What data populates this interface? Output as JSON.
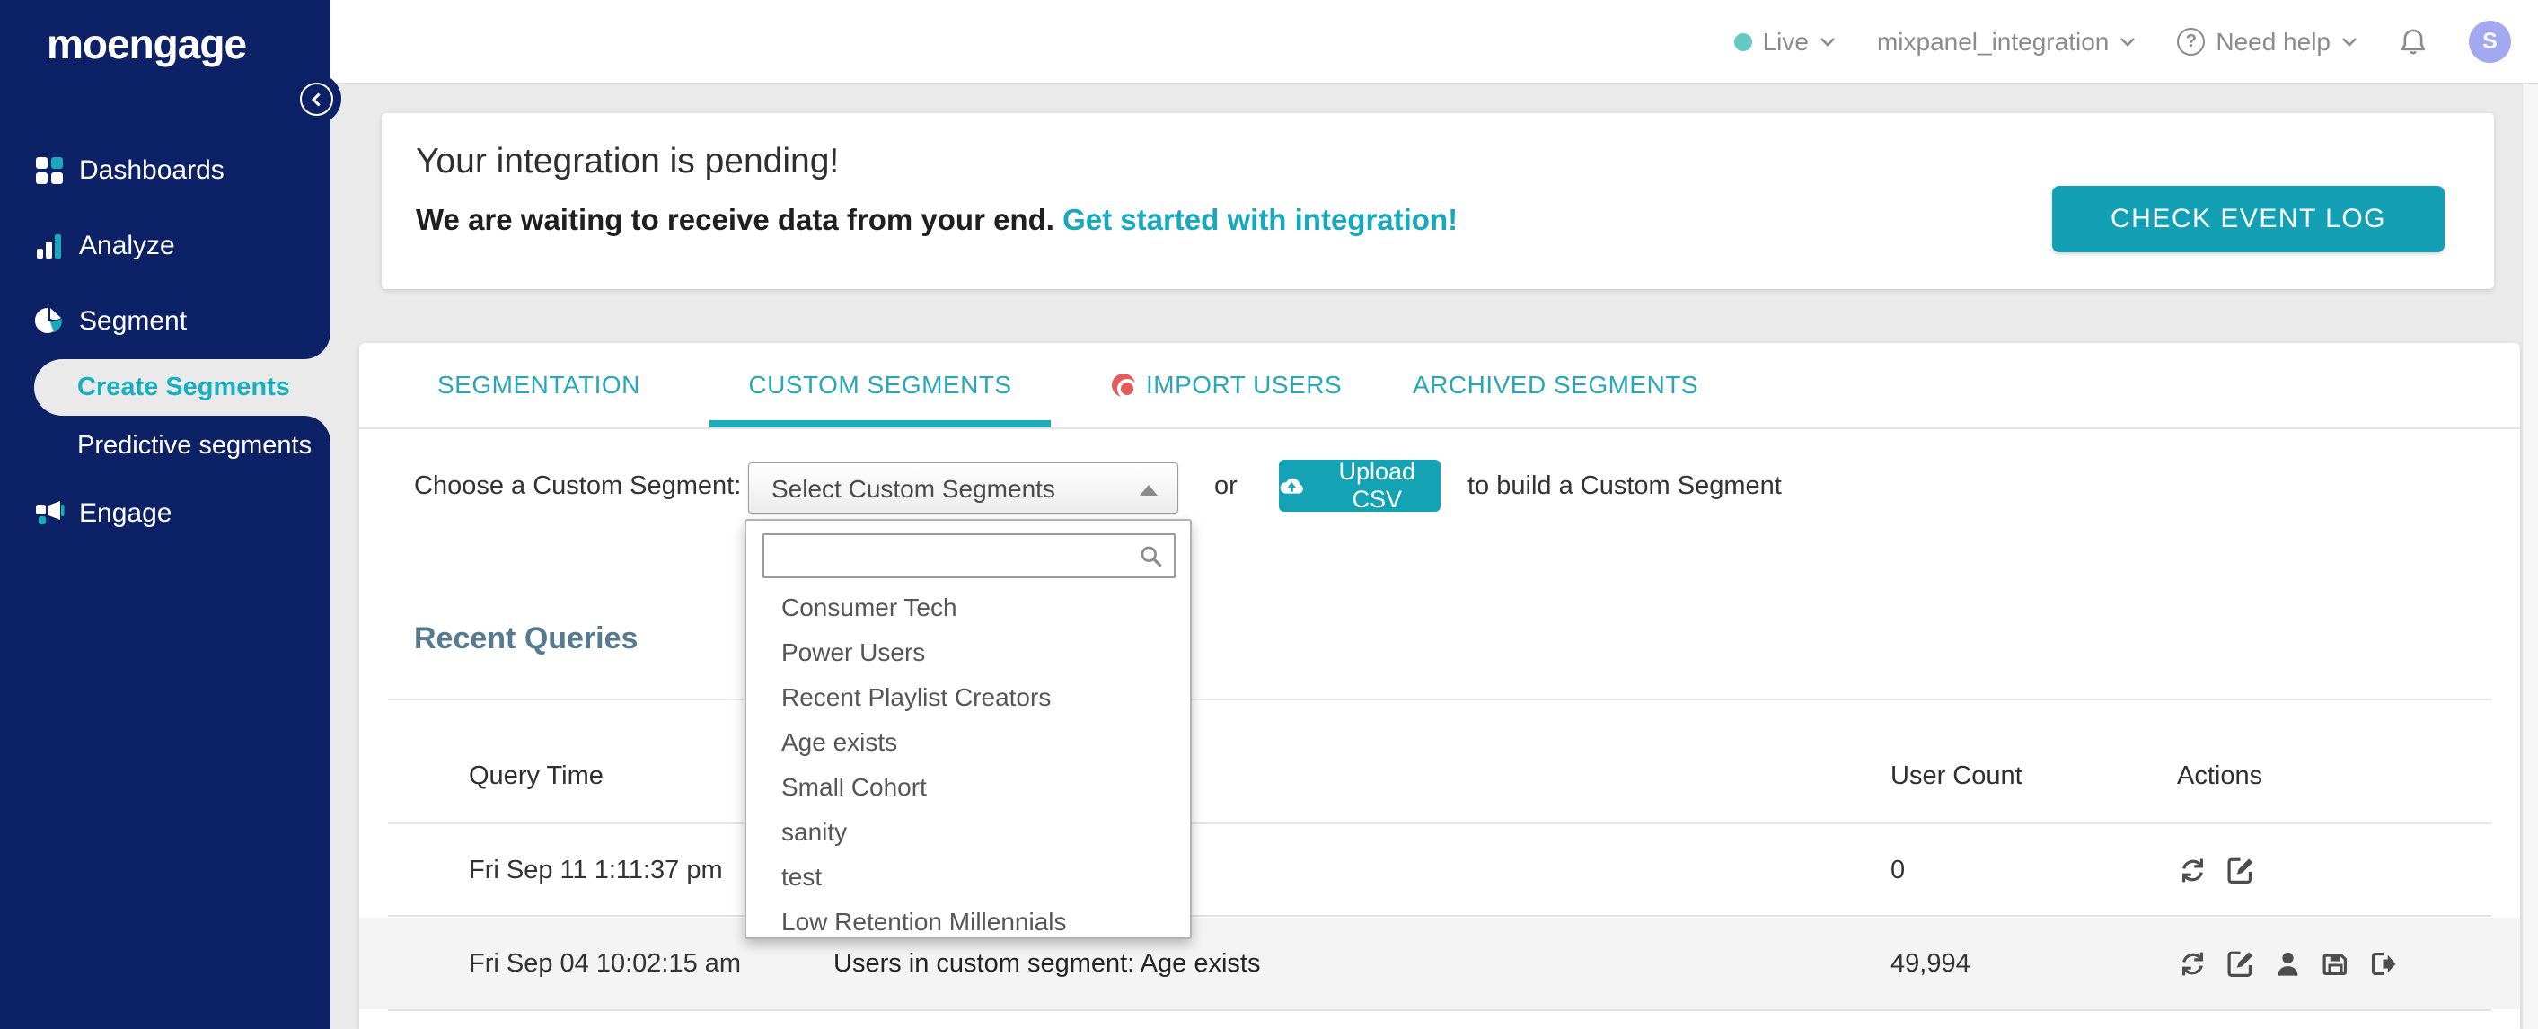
{
  "topbar": {
    "live_label": "Live",
    "project_name": "mixpanel_integration",
    "help_label": "Need help",
    "avatar_initial": "S"
  },
  "sidebar": {
    "logo": "moengage",
    "items": [
      {
        "label": "Dashboards"
      },
      {
        "label": "Analyze"
      },
      {
        "label": "Segment"
      },
      {
        "label": "Create Segments",
        "active": true
      },
      {
        "label": "Predictive segments"
      },
      {
        "label": "Engage"
      }
    ]
  },
  "banner": {
    "title": "Your integration is pending!",
    "message": "We are waiting to receive data from your end.",
    "link": "Get started with integration!",
    "button": "CHECK EVENT LOG"
  },
  "tabs": [
    {
      "label": "SEGMENTATION"
    },
    {
      "label": "CUSTOM SEGMENTS",
      "active": true
    },
    {
      "label": "IMPORT USERS",
      "icon": "import-dot-icon"
    },
    {
      "label": "ARCHIVED SEGMENTS"
    }
  ],
  "segment_chooser": {
    "label": "Choose a Custom Segment:",
    "select_value": "Select Custom Segments",
    "or_text": "or",
    "upload_button": "Upload CSV",
    "suffix": "to build a Custom Segment",
    "search_placeholder": ""
  },
  "dropdown": {
    "options": [
      "Consumer Tech",
      "Power Users",
      "Recent Playlist Creators",
      "Age exists",
      "Small Cohort",
      "sanity",
      "test",
      "Low Retention Millennials"
    ]
  },
  "recent_queries": {
    "title": "Recent Queries",
    "columns": [
      "Query Time",
      "User Count",
      "Actions"
    ],
    "rows": [
      {
        "time": "Fri Sep 11 1:11:37 pm",
        "query": "",
        "count": "0",
        "actions": [
          "refresh",
          "edit"
        ]
      },
      {
        "time": "Fri Sep 04 10:02:15 am",
        "query": "Users in custom segment: Age exists",
        "count": "49,994",
        "actions": [
          "refresh",
          "edit",
          "user",
          "save",
          "export"
        ]
      }
    ]
  },
  "colors": {
    "accent_teal": "#14a3b5",
    "sidebar_navy": "#0d2166",
    "import_dot_red": "#e25c5c",
    "live_dot_teal": "#63cac1",
    "avatar_purple": "#a2a9f1",
    "heading_slate": "#567a90",
    "row_alt_gray": "#f4f4f4"
  }
}
